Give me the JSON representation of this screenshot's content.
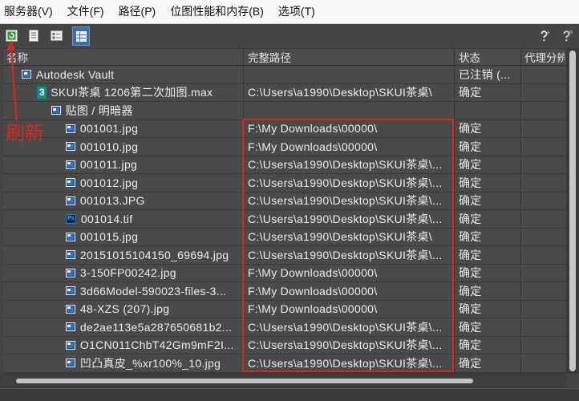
{
  "menu": {
    "items": [
      {
        "label": "服务器(V)"
      },
      {
        "label": "文件(F)"
      },
      {
        "label": "路径(P)"
      },
      {
        "label": "位图性能和内存(B)"
      },
      {
        "label": "选项(T)"
      }
    ]
  },
  "toolbar": {
    "left_icons": [
      "refresh-icon",
      "list-view-icon",
      "details-view-icon",
      "table-view-icon"
    ],
    "right_icons": [
      "help-icon",
      "help-about-icon"
    ],
    "active_view": "table-view"
  },
  "table": {
    "columns": {
      "name": "名称",
      "path": "完整路径",
      "status": "状态",
      "proxy": "代理分辨"
    },
    "rows": [
      {
        "level": 0,
        "icon": "vault-icon",
        "name": "Autodesk Vault",
        "status": "已注销 (..."
      },
      {
        "level": 1,
        "icon": "max-file-icon",
        "icon_text": "3",
        "name": "SKUI茶桌 1206第二次加图.max",
        "path": "C:\\Users\\a1990\\Desktop\\SKUI茶桌\\",
        "status": "确定"
      },
      {
        "level": 2,
        "icon": "maps-shaders-icon",
        "name": "贴图 / 明暗器"
      },
      {
        "level": 3,
        "icon": "bitmap-icon",
        "name": "001001.jpg",
        "path": "F:\\My Downloads\\00000\\",
        "status": "确定"
      },
      {
        "level": 3,
        "icon": "bitmap-icon",
        "name": "001010.jpg",
        "path": "F:\\My Downloads\\00000\\",
        "status": "确定"
      },
      {
        "level": 3,
        "icon": "bitmap-icon",
        "name": "001011.jpg",
        "path": "C:\\Users\\a1990\\Desktop\\SKUI茶桌\\...",
        "status": "确定"
      },
      {
        "level": 3,
        "icon": "bitmap-icon",
        "name": "001012.jpg",
        "path": "C:\\Users\\a1990\\Desktop\\SKUI茶桌\\...",
        "status": "确定"
      },
      {
        "level": 3,
        "icon": "bitmap-icon",
        "name": "001013.JPG",
        "path": "C:\\Users\\a1990\\Desktop\\SKUI茶桌\\...",
        "status": "确定"
      },
      {
        "level": 3,
        "icon": "psd-icon",
        "icon_text": "Ps",
        "name": "001014.tif",
        "path": "C:\\Users\\a1990\\Desktop\\SKUI茶桌\\...",
        "status": "确定"
      },
      {
        "level": 3,
        "icon": "bitmap-icon",
        "name": "001015.jpg",
        "path": "C:\\Users\\a1990\\Desktop\\SKUI茶桌\\",
        "status": "确定"
      },
      {
        "level": 3,
        "icon": "bitmap-icon",
        "name": "20151015104150_69694.jpg",
        "path": "C:\\Users\\a1990\\Desktop\\SKUI茶桌\\...",
        "status": "确定"
      },
      {
        "level": 3,
        "icon": "bitmap-icon",
        "name": "3-150FP00242.jpg",
        "path": "F:\\My Downloads\\00000\\",
        "status": "确定"
      },
      {
        "level": 3,
        "icon": "bitmap-icon",
        "name": "3d66Model-590023-files-3...",
        "path": "F:\\My Downloads\\00000\\",
        "status": "确定"
      },
      {
        "level": 3,
        "icon": "bitmap-icon",
        "name": "48-XZS (207).jpg",
        "path": "F:\\My Downloads\\00000\\",
        "status": "确定"
      },
      {
        "level": 3,
        "icon": "bitmap-icon",
        "name": "de2ae113e5a287650681b2...",
        "path": "C:\\Users\\a1990\\Desktop\\SKUI茶桌\\...",
        "status": "确定"
      },
      {
        "level": 3,
        "icon": "bitmap-icon",
        "name": "O1CN011ChbT42Gm9mF2I...",
        "path": "C:\\Users\\a1990\\Desktop\\SKUI茶桌\\...",
        "status": "确定"
      },
      {
        "level": 3,
        "icon": "bitmap-icon",
        "name": "凹凸真皮_%xr100%_10.jpg",
        "path": "C:\\Users\\a1990\\Desktop\\SKUI茶桌\\...",
        "status": "确定"
      }
    ]
  },
  "annotations": {
    "refresh_label": "刷新"
  },
  "colors": {
    "annotation_red": "#d8281d",
    "active_button": "#3d6ea8",
    "panel_bg": "#4a4a4a",
    "text": "#ececec"
  }
}
